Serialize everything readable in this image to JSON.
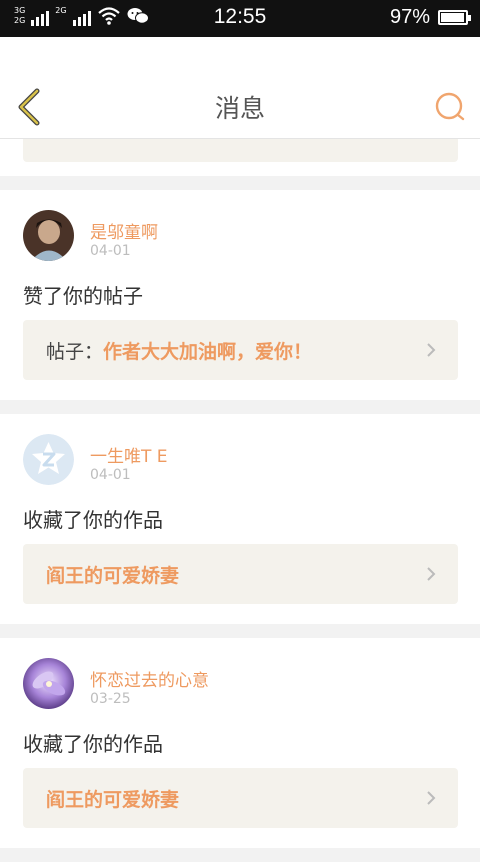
{
  "status_bar": {
    "network_1": "3G",
    "network_2": "2G",
    "network_3": "2G",
    "time": "12:55",
    "battery": "97%",
    "battery_level": 0.97
  },
  "header": {
    "title": "消息"
  },
  "colors": {
    "accent": "#ee9a60",
    "back_icon": "#d8c24a",
    "card_bg": "#f4f2ec"
  },
  "messages": [
    {
      "user": "是邬童啊",
      "date": "04-01",
      "action": "赞了你的帖子",
      "content_label": "帖子：",
      "content": "作者大大加油啊，爱你！"
    },
    {
      "user": "一生唯T E",
      "date": "04-01",
      "action": "收藏了你的作品",
      "content_label": "",
      "content": "阎王的可爱娇妻"
    },
    {
      "user": "怀恋过去的心意",
      "date": "03-25",
      "action": "收藏了你的作品",
      "content_label": "",
      "content": "阎王的可爱娇妻"
    }
  ]
}
